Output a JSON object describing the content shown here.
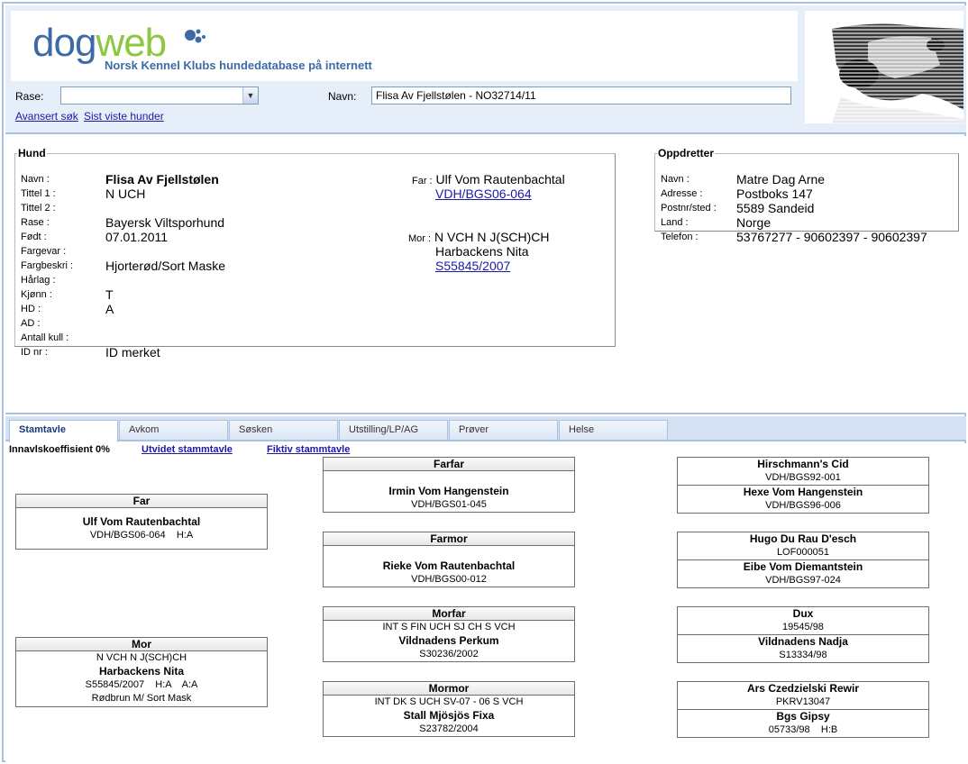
{
  "logo": {
    "text_dog": "dog",
    "text_web": "web",
    "subtitle": "Norsk Kennel Klubs hundedatabase på internett"
  },
  "search": {
    "rase_label": "Rase:",
    "rase_value": "",
    "navn_label": "Navn:",
    "navn_value": "Flisa Av Fjellstølen - NO32714/11",
    "advanced_link": "Avansert søk",
    "recent_link": "Sist viste hunder"
  },
  "hund": {
    "legend": "Hund",
    "rows": [
      {
        "key": "Navn :",
        "value": "Flisa Av Fjellstølen"
      },
      {
        "key": "Tittel 1 :",
        "value": "N UCH"
      },
      {
        "key": "Tittel 2 :",
        "value": ""
      },
      {
        "key": "Rase :",
        "value": "Bayersk Viltsporhund"
      },
      {
        "key": "Født :",
        "value": "07.01.2011"
      },
      {
        "key": "Fargevar :",
        "value": ""
      },
      {
        "key": "Fargbeskri :",
        "value": "Hjorterød/Sort Maske"
      },
      {
        "key": "Hårlag :",
        "value": ""
      },
      {
        "key": "Kjønn :",
        "value": "T"
      },
      {
        "key": "HD :",
        "value": "A"
      },
      {
        "key": "AD :",
        "value": ""
      },
      {
        "key": "Antall kull :",
        "value": ""
      },
      {
        "key": "ID nr :",
        "value": "ID merket"
      }
    ],
    "far_label": "Far :",
    "far_name": "Ulf Vom Rautenbachtal",
    "far_reg": "VDH/BGS06-064",
    "mor_label": "Mor :",
    "mor_title": "N VCH N J(SCH)CH",
    "mor_name": "Harbackens Nita",
    "mor_reg": "S55845/2007"
  },
  "oppdretter": {
    "legend": "Oppdretter",
    "rows": [
      {
        "key": "Navn :",
        "value": "Matre Dag Arne"
      },
      {
        "key": "Adresse :",
        "value": "Postboks 147"
      },
      {
        "key": "Postnr/sted :",
        "value": "5589 Sandeid"
      },
      {
        "key": "Land :",
        "value": "Norge"
      },
      {
        "key": "Telefon :",
        "value": "53767277 - 90602397 - 90602397"
      }
    ]
  },
  "tabs": [
    "Stamtavle",
    "Avkom",
    "Søsken",
    "Utstilling/LP/AG",
    "Prøver",
    "Helse"
  ],
  "active_tab": 0,
  "pedigree": {
    "inbreeding": "Innavlskoeffisient 0%",
    "extended_link": "Utvidet stammtavle",
    "fictive_link": "Fiktiv stammtavle",
    "far": {
      "header": "Far",
      "name": "Ulf Vom Rautenbachtal",
      "info": "VDH/BGS06-064    H:A"
    },
    "mor": {
      "header": "Mor",
      "title": "N VCH N J(SCH)CH",
      "name": "Harbackens Nita",
      "info": "S55845/2007    H:A    A:A",
      "color": "Rødbrun M/ Sort Mask"
    },
    "farfar": {
      "header": "Farfar",
      "name": "Irmin Vom Hangenstein",
      "reg": "VDH/BGS01-045"
    },
    "farmor": {
      "header": "Farmor",
      "name": "Rieke Vom Rautenbachtal",
      "reg": "VDH/BGS00-012"
    },
    "morfar": {
      "header": "Morfar",
      "title": "INT S FIN UCH SJ CH S VCH",
      "name": "Vildnadens Perkum",
      "reg": "S30236/2002"
    },
    "mormor": {
      "header": "Mormor",
      "title": "INT DK S UCH SV-07 - 06 S VCH",
      "name": "Stall Mjösjös Fixa",
      "reg": "S23782/2004"
    },
    "gg": [
      {
        "name": "Hirschmann's Cid",
        "reg": "VDH/BGS92-001"
      },
      {
        "name": "Hexe Vom Hangenstein",
        "reg": "VDH/BGS96-006"
      },
      {
        "name": "Hugo Du Rau D'esch",
        "reg": "LOF000051"
      },
      {
        "name": "Eibe Vom Diemantstein",
        "reg": "VDH/BGS97-024"
      },
      {
        "name": "Dux",
        "reg": "19545/98"
      },
      {
        "name": "Vildnadens Nadja",
        "reg": "S13334/98"
      },
      {
        "name": "Ars Czedzielski Rewir",
        "reg": "PKRV13047"
      },
      {
        "name": "Bgs Gipsy",
        "reg": "05733/98    H:B"
      }
    ]
  },
  "colors": {
    "header_bg": "#e6eefa",
    "border": "#a9c1e3",
    "logo_blue": "#3d6aa6",
    "logo_green": "#8dc63f",
    "link": "#1a1aa6"
  }
}
